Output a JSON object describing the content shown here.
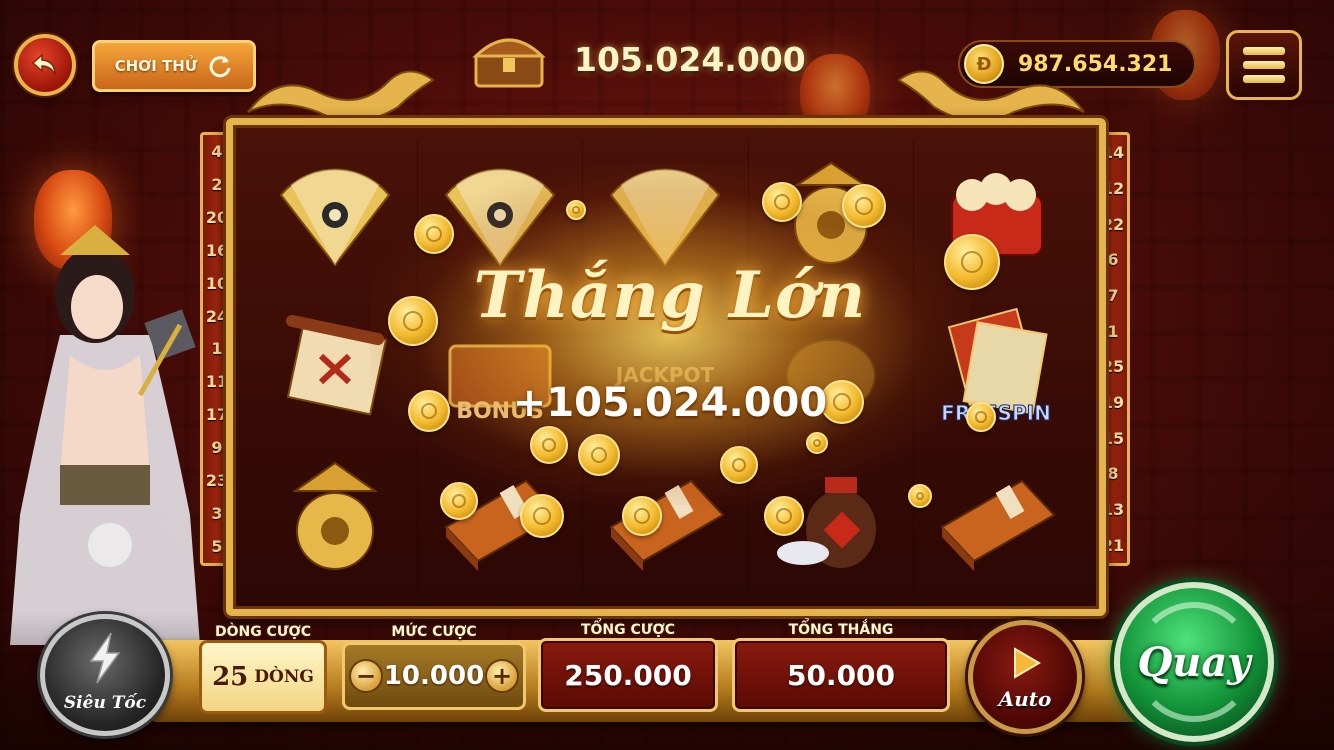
{
  "top_bar": {
    "demo_label": "CHƠI THỬ",
    "jackpot_value": "105.024.000",
    "balance_value": "987.654.321",
    "coin_glyph": "Đ"
  },
  "paylines": {
    "left": [
      "4",
      "2",
      "20",
      "16",
      "10",
      "24",
      "1",
      "11",
      "17",
      "9",
      "23",
      "3",
      "5"
    ],
    "right": [
      "14",
      "12",
      "22",
      "6",
      "7",
      "1",
      "25",
      "19",
      "15",
      "8",
      "13",
      "21"
    ]
  },
  "reels": {
    "symbols": [
      [
        "fan-icon",
        "fan-icon",
        "fan-icon",
        "lantern-icon",
        "firecracker-icon"
      ],
      [
        "scroll-icon",
        "bonus-chest-icon",
        "jackpot-icon",
        "teapot-icon",
        "freespin-icon"
      ],
      [
        "lantern-icon",
        "book-icon",
        "book-icon",
        "wine-jar-icon",
        "book-icon"
      ]
    ],
    "overlay_texts": {
      "bonus": "BONUS",
      "jackpot": "JACKPOT",
      "freespin": "FREESPIN"
    }
  },
  "win": {
    "title": "Thắng Lớn",
    "amount": "+105.024.000"
  },
  "controls": {
    "turbo_label": "Siêu Tốc",
    "lines_label": "DÒNG CƯỢC",
    "lines_value": "25",
    "lines_unit": "DÒNG",
    "bet_label": "MỨC CƯỢC",
    "bet_value": "10.000",
    "bet_minus": "−",
    "bet_plus": "+",
    "total_bet_label": "TỔNG CƯỢC",
    "total_bet_value": "250.000",
    "total_win_label": "TỔNG THẮNG",
    "total_win_value": "50.000",
    "auto_label": "Auto",
    "spin_label": "Quay"
  },
  "colors": {
    "gold": "#e6b44c",
    "crimson": "#7a1a10",
    "spin_green": "#129238"
  }
}
